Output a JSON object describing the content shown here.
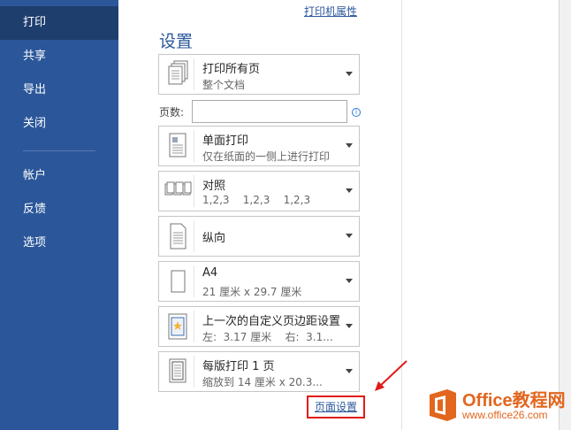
{
  "sidebar": {
    "items": [
      {
        "label": "打印",
        "active": true
      },
      {
        "label": "共享"
      },
      {
        "label": "导出"
      },
      {
        "label": "关闭"
      },
      {
        "label": "帐户"
      },
      {
        "label": "反馈"
      },
      {
        "label": "选项"
      }
    ]
  },
  "printer_properties_link": "打印机属性",
  "settings": {
    "title": "设置",
    "print_range": {
      "main": "打印所有页",
      "sub": "整个文档"
    },
    "pages_label": "页数:",
    "pages_value": "",
    "sides": {
      "main": "单面打印",
      "sub": "仅在纸面的一侧上进行打印"
    },
    "collation": {
      "main": "对照",
      "sub": "1,2,3    1,2,3    1,2,3"
    },
    "orientation": {
      "main": "纵向"
    },
    "paper_size": {
      "main": "A4",
      "sub": "21 厘米 x 29.7 厘米"
    },
    "margins": {
      "main": "上一次的自定义页边距设置",
      "sub": "左:  3.17 厘米    右:  3.1..."
    },
    "pages_per_sheet": {
      "main": "每版打印 1 页",
      "sub": "缩放到 14 厘米 x 20.3..."
    },
    "page_setup_link": "页面设置"
  },
  "watermark": {
    "brand": "Office教程网",
    "url": "www.office26.com"
  },
  "colors": {
    "sidebar": "#2b579a",
    "highlight": "#e11a1a",
    "brand": "#e2661e"
  }
}
